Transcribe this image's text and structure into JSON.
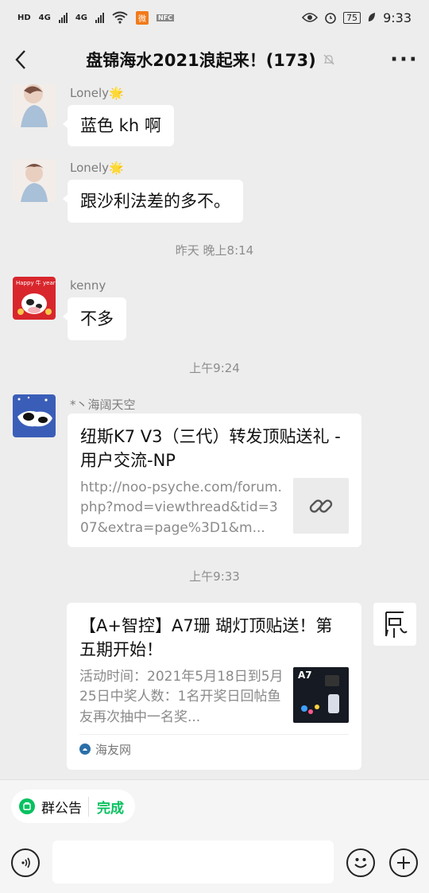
{
  "status_bar": {
    "hd": "HD",
    "net1": "4G",
    "net2": "4G",
    "badge": "微",
    "small_tag": "NFC",
    "battery": "75",
    "time": "9:33"
  },
  "header": {
    "title": "盘锦海水2021浪起来！(173)"
  },
  "messages": [
    {
      "nick": "Lonely🌟",
      "text": "蓝色 kh 啊"
    },
    {
      "nick": "Lonely🌟",
      "text": "跟沙利法差的多不。"
    },
    {
      "time": "昨天 晚上8:14"
    },
    {
      "nick": "kenny",
      "text": "不多"
    },
    {
      "time": "上午9:24"
    },
    {
      "nick": "*丶海阔天空",
      "card_title": "纽斯K7 V3（三代）转发顶贴送礼 - 用户交流-NP",
      "card_desc": "http://noo-psyche.com/forum.php?mod=viewthread&tid=307&extra=page%3D1&m..."
    },
    {
      "time": "上午9:33"
    },
    {
      "card_title": "【A+智控】A7珊 瑚灯顶贴送！第五期开始！",
      "card_desc": "活动时间：2021年5月18日到5月25日中奖人数：1名开奖日回帖鱼友再次抽中一名奖...",
      "source": "海友网",
      "thumb_label": "A7"
    }
  ],
  "bottom": {
    "announcement": "群公告",
    "done": "完成"
  },
  "colors": {
    "accent": "#07c160",
    "background": "#ededed"
  }
}
